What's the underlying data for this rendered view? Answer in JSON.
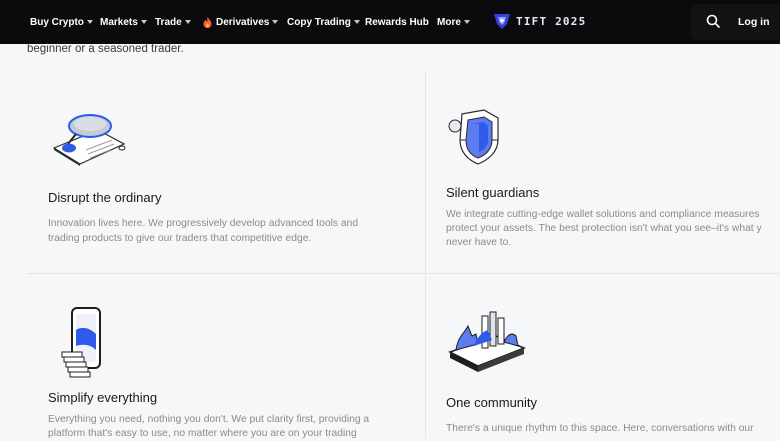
{
  "nav": {
    "items": [
      {
        "label": "Buy Crypto"
      },
      {
        "label": "Markets"
      },
      {
        "label": "Trade"
      },
      {
        "label": "Derivatives"
      },
      {
        "label": "Copy Trading"
      },
      {
        "label": "Rewards Hub"
      },
      {
        "label": "More"
      }
    ],
    "brand": "TIFT 2025",
    "login": "Log in"
  },
  "intro_line": "beginner or a seasoned trader.",
  "features": [
    {
      "title": "Disrupt the ordinary",
      "lines": [
        "Innovation lives here. We progressively develop advanced tools and",
        "trading products to give our traders that competitive edge."
      ]
    },
    {
      "title": "Silent guardians",
      "lines": [
        "We integrate cutting-edge wallet solutions and compliance measures",
        "protect your assets. The best protection isn't what you see–it's what y",
        "never have to."
      ]
    },
    {
      "title": "Simplify everything",
      "lines": [
        "Everything you need, nothing you don't. We put clarity first, providing a",
        "platform that's easy to use, no matter where you are on your trading"
      ]
    },
    {
      "title": "One community",
      "lines": [
        "There's a unique rhythm to this space. Here, conversations with our"
      ]
    }
  ],
  "colors": {
    "nav_bg": "#0b0b0d",
    "page_bg": "#f6f7f9",
    "accent_blue": "#2f5bea"
  }
}
